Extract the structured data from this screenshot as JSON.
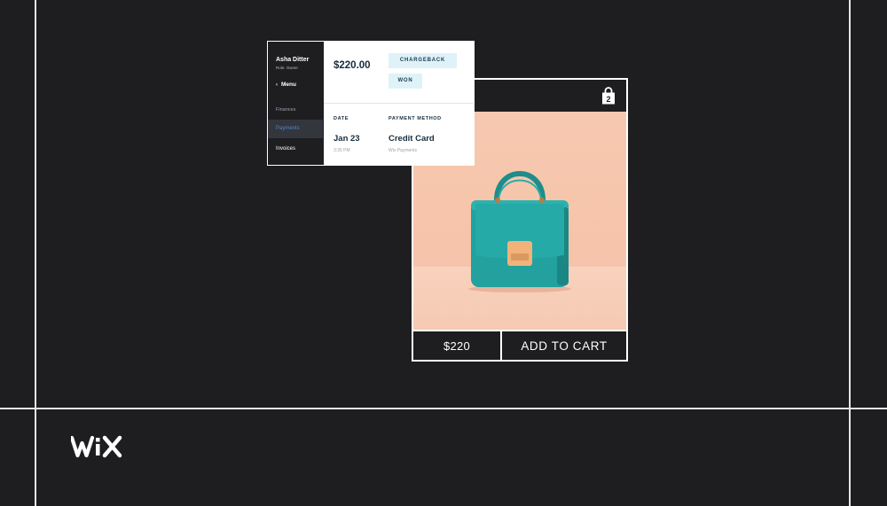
{
  "dashboard": {
    "user": {
      "name": "Asha Ditter",
      "role": "Role: Owner"
    },
    "menu_label": "Menu",
    "sidebar": [
      {
        "label": "Finances"
      },
      {
        "label": "Payments"
      },
      {
        "label": "Invoices"
      }
    ],
    "amount": "$220.00",
    "badges": {
      "chargeback": "CHARGEBACK",
      "won": "WON"
    },
    "date": {
      "label": "DATE",
      "value": "Jan 23",
      "sub": "3:35 PM"
    },
    "payment_method": {
      "label": "PAYMENT METHOD",
      "value": "Credit Card",
      "sub": "Wix Payments"
    }
  },
  "product_card": {
    "cart_count": "2",
    "price": "$220",
    "add_to_cart_label": "ADD TO CART",
    "product_icon": "handbag",
    "image_colors": {
      "background": "#f7c8b0",
      "bag": "#23a3a0",
      "clasp": "#f0b27a"
    }
  },
  "brand": {
    "logo": "WiX"
  },
  "colors": {
    "page_background": "#1e1e21",
    "grid_lines": "#e6e6e6",
    "sidebar_bg": "#1e1e21",
    "active_item_bg": "#33363d",
    "active_item_text": "#4f86c6",
    "badge_bg": "#def2f8",
    "heading_text": "#162d3d"
  }
}
